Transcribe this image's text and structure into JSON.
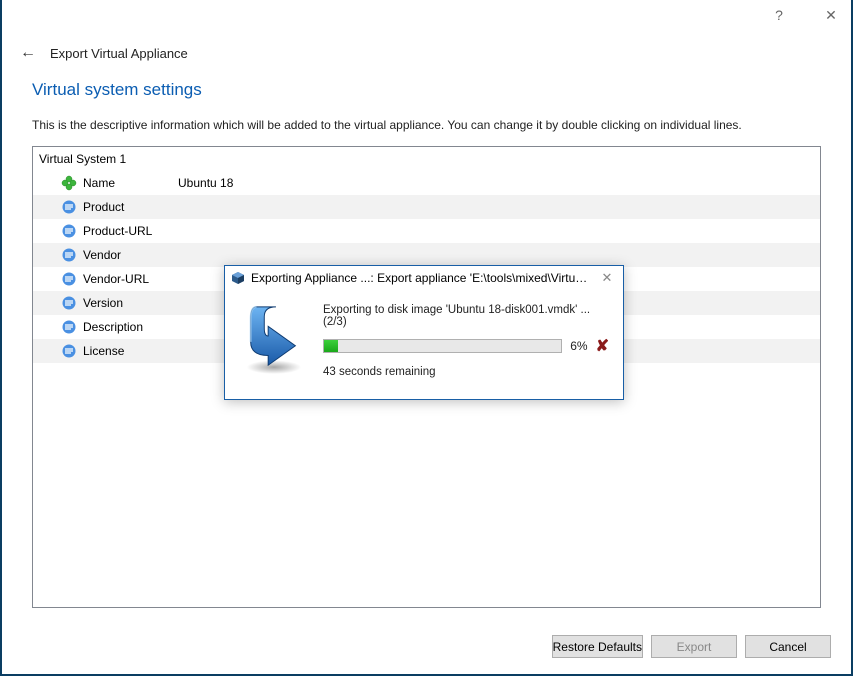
{
  "window": {
    "help_tooltip": "?",
    "close_tooltip": "✕",
    "back_tooltip": "←",
    "header_title": "Export Virtual Appliance"
  },
  "section": {
    "title": "Virtual system settings",
    "description": "This is the descriptive information which will be added to the virtual appliance. You can change it by double clicking on individual lines."
  },
  "system": {
    "group_label": "Virtual System 1",
    "rows": [
      {
        "label": "Name",
        "value": "Ubuntu 18",
        "icon": "clover"
      },
      {
        "label": "Product",
        "value": "",
        "icon": "text"
      },
      {
        "label": "Product-URL",
        "value": "",
        "icon": "text"
      },
      {
        "label": "Vendor",
        "value": "",
        "icon": "text"
      },
      {
        "label": "Vendor-URL",
        "value": "",
        "icon": "text"
      },
      {
        "label": "Version",
        "value": "",
        "icon": "text"
      },
      {
        "label": "Description",
        "value": "",
        "icon": "text"
      },
      {
        "label": "License",
        "value": "",
        "icon": "text"
      }
    ]
  },
  "footer": {
    "restore_defaults": "Restore Defaults",
    "export": "Export",
    "cancel": "Cancel"
  },
  "modal": {
    "title": "Exporting Appliance ...: Export appliance 'E:\\tools\\mixed\\Virtua...",
    "status": "Exporting to disk image 'Ubuntu 18-disk001.vmdk' ... (2/3)",
    "percent_label": "6%",
    "percent_value": 6,
    "remaining": "43 seconds remaining"
  }
}
